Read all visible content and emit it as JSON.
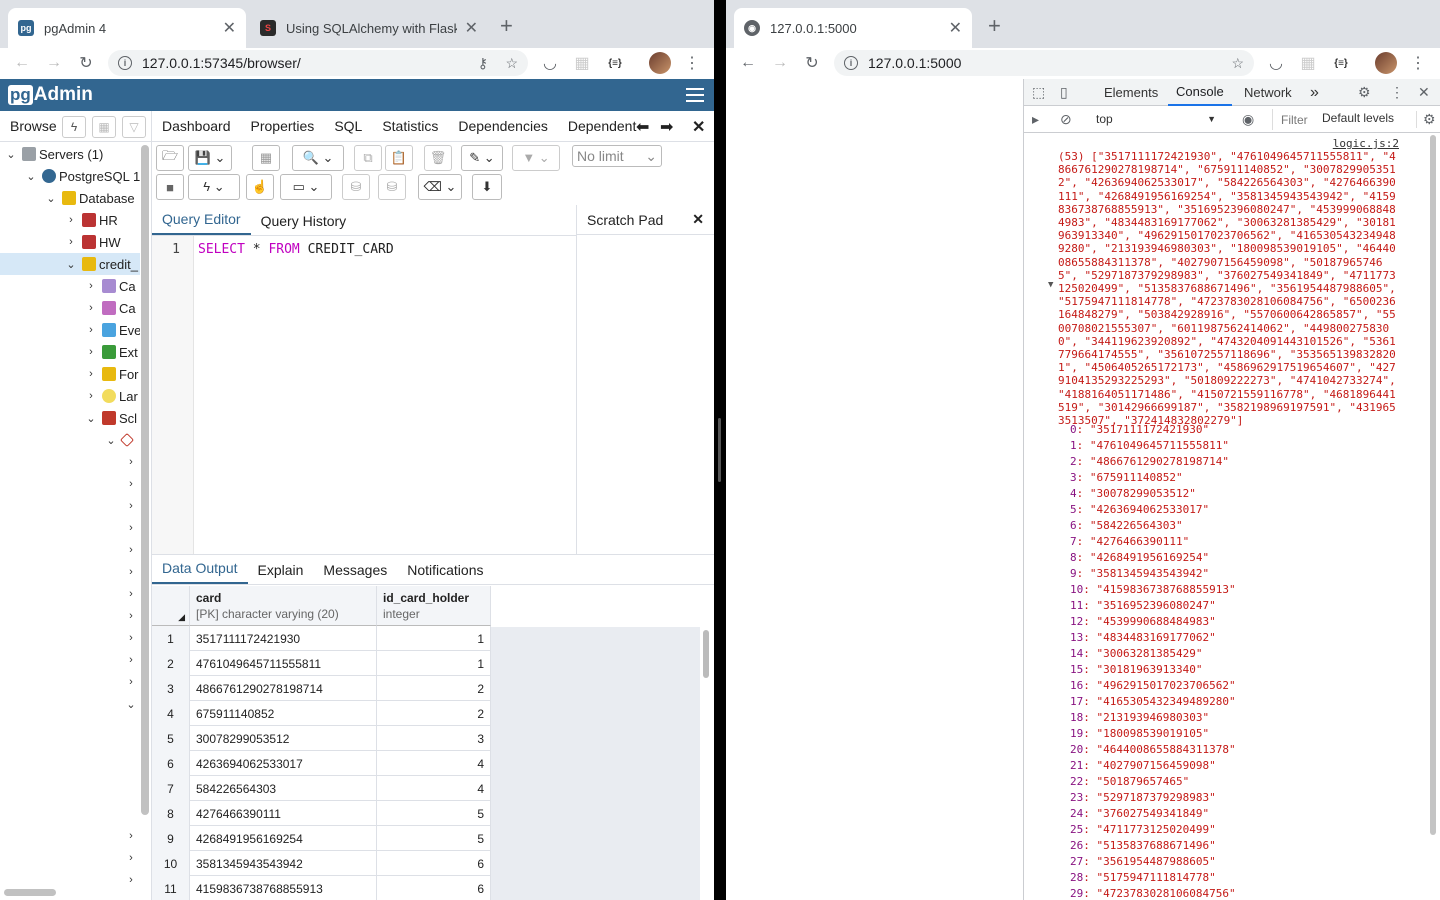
{
  "left_window": {
    "tabs": [
      {
        "title": "pgAdmin 4",
        "active": true
      },
      {
        "title": "Using SQLAlchemy with Flask a",
        "active": false
      }
    ],
    "address": "127.0.0.1:57345/browser/"
  },
  "right_window": {
    "tabs": [
      {
        "title": "127.0.0.1:5000",
        "active": true
      }
    ],
    "address": "127.0.0.1:5000"
  },
  "pgadmin": {
    "logo_pg": "pg",
    "logo_rest": "Admin",
    "browser_title": "Browse",
    "tree": {
      "servers": "Servers (1)",
      "postgres": "PostgreSQL 1",
      "databases": "Database",
      "hr": "HR",
      "hw": "HW",
      "credit": "credit_",
      "ca1": "Ca",
      "ca2": "Ca",
      "eve": "Eve",
      "ext": "Ext",
      "for": "For",
      "lan": "Lar",
      "sch": "Scl"
    },
    "main_tabs": [
      "Dashboard",
      "Properties",
      "SQL",
      "Statistics",
      "Dependencies",
      "Dependent"
    ],
    "limit_select": "No limit",
    "editor_tabs": [
      "Query Editor",
      "Query History"
    ],
    "scratch_pad": "Scratch Pad",
    "line_number": "1",
    "sql": {
      "kw1": "SELECT",
      "rest1": " * ",
      "kw2": "FROM",
      "rest2": " CREDIT_CARD"
    },
    "output_tabs": [
      "Data Output",
      "Explain",
      "Messages",
      "Notifications"
    ],
    "columns": [
      {
        "name": "card",
        "type": "[PK] character varying (20)"
      },
      {
        "name": "id_card_holder",
        "type": "integer"
      }
    ],
    "rows": [
      [
        "1",
        "3517111172421930",
        "1"
      ],
      [
        "2",
        "4761049645711555811",
        "1"
      ],
      [
        "3",
        "4866761290278198714",
        "2"
      ],
      [
        "4",
        "675911140852",
        "2"
      ],
      [
        "5",
        "30078299053512",
        "3"
      ],
      [
        "6",
        "4263694062533017",
        "4"
      ],
      [
        "7",
        "584226564303",
        "4"
      ],
      [
        "8",
        "4276466390111",
        "5"
      ],
      [
        "9",
        "4268491956169254",
        "5"
      ],
      [
        "10",
        "3581345943543942",
        "6"
      ],
      [
        "11",
        "4159836738768855913",
        "6"
      ]
    ]
  },
  "devtools": {
    "tabs": [
      "Elements",
      "Console",
      "Network"
    ],
    "more": "»",
    "context": "top",
    "filter_placeholder": "Filter",
    "levels": "Default levels",
    "source": "logic.js:2",
    "array_summary": "(53) [\"3517111172421930\", \"4761049645711555811\", \"4866761290278198714\", \"675911140852\", \"30078299053512\", \"4263694062533017\", \"584226564303\", \"4276466390111\", \"4268491956169254\", \"3581345943543942\", \"4159836738768855913\", \"3516952396080247\", \"4539990688484983\", \"4834483169177062\", \"30063281385429\", \"30181963913340\", \"4962915017023706562\", \"4165305432349489280\", \"213193946980303\", \"180098539019105\", \"4644008655884311378\", \"4027907156459098\", \"501879657465\", \"5297187379298983\", \"376027549341849\", \"4711773125020499\", \"5135837688671496\", \"3561954487988605\", \"5175947111814778\", \"4723783028106084756\", \"6500236164848279\", \"503842928916\", \"5570600642865857\", \"5500708021555307\", \"6011987562414062\", \"4498002758300\", \"344119623920892\", \"4743204091443101526\", \"5361779664174555\", \"3561072557118696\", \"3535651398328201\", \"4506405265172173\", \"4586962917519654607\", \"4279104135293225293\", \"501809222273\", \"4741042733274\", \"4188164051171486\", \"4150721559116778\", \"4681896441519\", \"30142966699187\", \"3582198969197591\", \"4319653513507\", \"372414832802279\"]",
    "entries": [
      [
        "0",
        "3517111172421930"
      ],
      [
        "1",
        "4761049645711555811"
      ],
      [
        "2",
        "4866761290278198714"
      ],
      [
        "3",
        "675911140852"
      ],
      [
        "4",
        "30078299053512"
      ],
      [
        "5",
        "4263694062533017"
      ],
      [
        "6",
        "584226564303"
      ],
      [
        "7",
        "4276466390111"
      ],
      [
        "8",
        "4268491956169254"
      ],
      [
        "9",
        "3581345943543942"
      ],
      [
        "10",
        "4159836738768855913"
      ],
      [
        "11",
        "3516952396080247"
      ],
      [
        "12",
        "4539990688484983"
      ],
      [
        "13",
        "4834483169177062"
      ],
      [
        "14",
        "30063281385429"
      ],
      [
        "15",
        "30181963913340"
      ],
      [
        "16",
        "4962915017023706562"
      ],
      [
        "17",
        "4165305432349489280"
      ],
      [
        "18",
        "213193946980303"
      ],
      [
        "19",
        "180098539019105"
      ],
      [
        "20",
        "4644008655884311378"
      ],
      [
        "21",
        "4027907156459098"
      ],
      [
        "22",
        "501879657465"
      ],
      [
        "23",
        "5297187379298983"
      ],
      [
        "24",
        "376027549341849"
      ],
      [
        "25",
        "4711773125020499"
      ],
      [
        "26",
        "5135837688671496"
      ],
      [
        "27",
        "3561954487988605"
      ],
      [
        "28",
        "5175947111814778"
      ],
      [
        "29",
        "4723783028106084756"
      ]
    ]
  },
  "colors": {
    "pg_blue": "#326690",
    "selection": "#d6e8f7",
    "string_red": "#c41a16",
    "index_purple": "#881280"
  }
}
